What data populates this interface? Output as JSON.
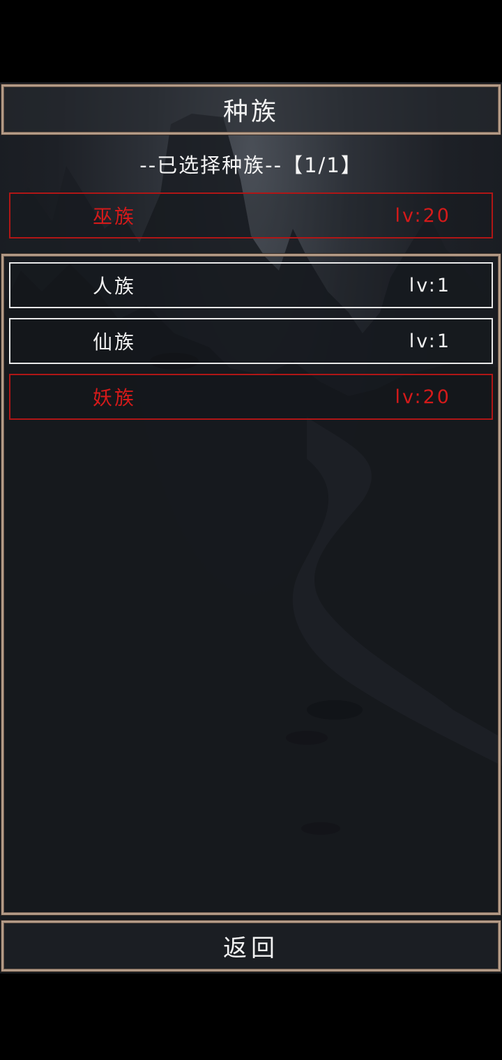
{
  "header": {
    "title": "种族"
  },
  "selected": {
    "caption": "--已选择种族--【1/1】",
    "race": {
      "name": "巫族",
      "level": "lv:20"
    }
  },
  "race_list": [
    {
      "name": "人族",
      "level": "lv:1"
    },
    {
      "name": "仙族",
      "level": "lv:1"
    },
    {
      "name": "妖族",
      "level": "lv:20"
    }
  ],
  "footer": {
    "back_label": "返回"
  },
  "colors": {
    "frame": "#b39a86",
    "highlight_red": "#d41a1a",
    "normal_white": "#f0f0f0"
  }
}
